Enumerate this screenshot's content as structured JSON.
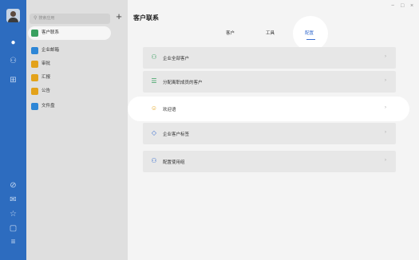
{
  "window": {
    "title": "客户联系",
    "min_label": "−",
    "max_label": "□",
    "close_label": "×"
  },
  "rail": {
    "icons": [
      "message-icon",
      "contacts-icon",
      "apps-icon",
      "check-icon",
      "mail-icon",
      "star-icon",
      "doc-icon",
      "menu-icon"
    ]
  },
  "search": {
    "placeholder": "搜索应用",
    "glyph": "⚲"
  },
  "add_glyph": "+",
  "apps": [
    {
      "label": "客户联系",
      "color": "#3aa060"
    },
    {
      "label": "企业邮箱",
      "color": "#2d86d6"
    },
    {
      "label": "审批",
      "color": "#e3a21a"
    },
    {
      "label": "汇报",
      "color": "#e3a21a"
    },
    {
      "label": "公告",
      "color": "#e3a21a"
    },
    {
      "label": "文件盘",
      "color": "#2d86d6"
    }
  ],
  "tabs": [
    "客户",
    "工具",
    "配置"
  ],
  "active_tab": "配置",
  "cards": [
    {
      "label": "企业全部客户",
      "glyph": "⚇",
      "chevron": "›"
    },
    {
      "label": "分配离职成员的客户",
      "glyph": "☰",
      "chevron": "›"
    },
    {
      "label": "欢迎语",
      "glyph": "☺",
      "chevron": "›"
    },
    {
      "label": "企业客户标签",
      "glyph": "◇",
      "chevron": "›"
    },
    {
      "label": "配置使用组",
      "glyph": "⚇",
      "chevron": "›"
    }
  ],
  "colors": {
    "rail": "#2d6cbf",
    "accent": "#3a6fd0"
  }
}
